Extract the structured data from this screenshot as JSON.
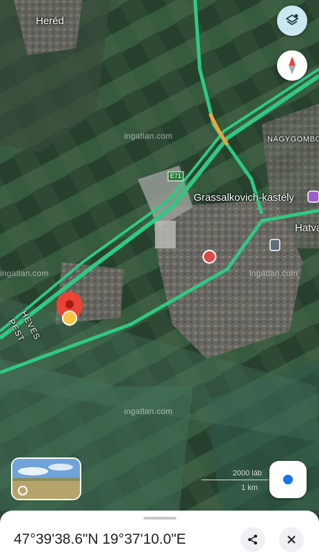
{
  "map": {
    "places": {
      "hered": "Heréd",
      "nagygombos": "NAGYGOMBOS",
      "grassalkovich": "Grassalkovich-kastély",
      "hatvan": "Hatvan",
      "heves": "HEVES",
      "pest": "PEST"
    },
    "road_shield": "E71",
    "watermark": "ingatlan.com",
    "colors": {
      "road": "#2fc981",
      "road_slow": "#f2a33a",
      "pin": "#ea4335",
      "accent": "#1a73e8"
    }
  },
  "controls": {
    "layers_icon": "layers-icon",
    "compass_icon": "compass-icon",
    "locate_icon": "my-location-icon"
  },
  "scale": {
    "imperial": "2000 láb",
    "metric": "1 km"
  },
  "sheet": {
    "coordinates": "47°39'38.6\"N 19°37'10.0\"E",
    "share_icon": "share-icon",
    "close_icon": "close-icon"
  }
}
